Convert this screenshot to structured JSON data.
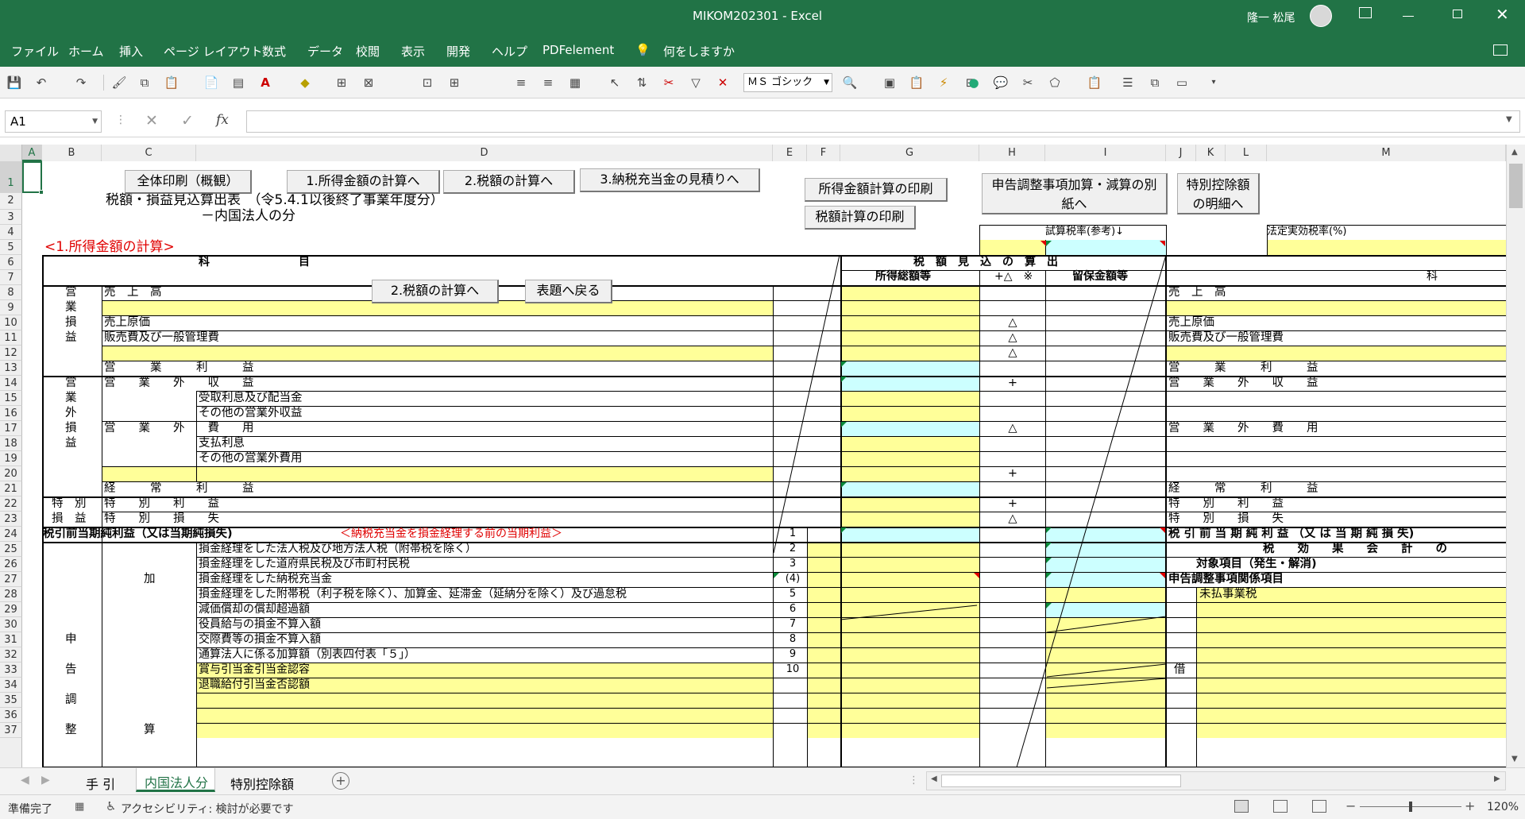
{
  "window": {
    "title": "MIKOM202301 - Excel",
    "user": "隆一 松尾"
  },
  "menu": [
    "ファイル",
    "ホーム",
    "挿入",
    "ページ レイアウト",
    "数式",
    "データ",
    "校閲",
    "表示",
    "開発",
    "ヘルプ",
    "PDFelement"
  ],
  "tellme": "何をしますか",
  "font_box": "ＭＳ ゴシック",
  "namebox": "A1",
  "fx": "fx",
  "columns": [
    "A",
    "B",
    "C",
    "D",
    "E",
    "F",
    "G",
    "H",
    "I",
    "J",
    "K",
    "L",
    "M"
  ],
  "rows": [
    "1",
    "2",
    "3",
    "4",
    "5",
    "6",
    "7",
    "8",
    "9",
    "10",
    "11",
    "12",
    "13",
    "14",
    "15",
    "16",
    "17",
    "18",
    "19",
    "20",
    "21",
    "22",
    "23",
    "24",
    "25",
    "26",
    "27",
    "28",
    "29",
    "30",
    "31",
    "32",
    "33",
    "34",
    "35",
    "36",
    "37"
  ],
  "buttons": {
    "print_all": "全体印刷（概観）",
    "calc_income": "1.所得金額の計算へ",
    "calc_tax": "2.税額の計算へ",
    "provision": "3.納税充当金の見積りへ",
    "print_income": "所得金額計算の印刷",
    "print_tax": "税額計算の印刷",
    "adjust": "申告調整事項加算・減算の別紙へ",
    "special": "特別控除額の明細へ",
    "tax_calc2": "2.税額の計算へ",
    "back": "表題へ戻る"
  },
  "sheet": {
    "title": "税額・損益見込算出表　（令5.4.1以後終了事業年度分）",
    "subtitle": "－内国法人の分",
    "section": "<1.所得金額の計算>",
    "ref_rate": "試算税率(参考)↓",
    "legal_rate": "法定実効税率(%)",
    "h_item": "科　　　　　　　　目",
    "h_est": "税　額　見　込　の　算　出",
    "h_total": "所得総額等",
    "h_mark": "+△　※",
    "h_reserve": "留保金額等",
    "h_m": "科",
    "b8": "営",
    "b9": "業",
    "b10": "損",
    "b11": "益",
    "b14": "営",
    "b15": "業",
    "b16": "外",
    "b17": "損",
    "b18": "益",
    "b22": "特　別",
    "b23": "損　益",
    "r8": "売　上　高",
    "r10": "売上原価",
    "r11": "販売費及び一般管理費",
    "r13": "営　　　業　　　利　　　益",
    "r14": "営　　業　　外　　収　　益",
    "r15": "受取利息及び配当金",
    "r16": "その他の営業外収益",
    "r17": "営　　業　　外　　費　　用",
    "r18": "支払利息",
    "r19": "その他の営業外費用",
    "r21": "経　　　常　　　利　　　益",
    "r22": "特　　別　　利　　益",
    "r23": "特　　別　　損　　失",
    "r24": "税引前当期純利益（又は当期純損失)",
    "r24note": "＜納税充当金を損金経理する前の当期利益＞",
    "r25": "損金経理をした法人税及び地方法人税（附帯税を除く）",
    "r26": "損金経理をした道府県民税及び市町村民税",
    "r27": "損金経理をした納税充当金",
    "r28": "損金経理をした附帯税（利子税を除く）、加算金、延滞金（延納分を除く）及び過怠税",
    "r29": "減価償却の償却超過額",
    "r30": "役員給与の損金不算入額",
    "r31": "交際費等の損金不算入額",
    "r32": "通算法人に係る加算額（別表四付表「５」）",
    "r33": "賞与引当金引当金認容",
    "r34": "退職給付引当金否認額",
    "c27": "加",
    "b31": "申",
    "b33": "告",
    "b35": "調",
    "b37": "整",
    "c37": "算",
    "n24": "1",
    "n25": "2",
    "n26": "3",
    "n27": "(4)",
    "n28": "5",
    "n29": "6",
    "n30": "7",
    "n31": "8",
    "n32": "9",
    "n33": "10",
    "h10": "△",
    "h11": "△",
    "h12": "△",
    "h14": "+",
    "h17": "△",
    "h20": "+",
    "h22": "+",
    "h23": "△",
    "m8": "売　上　高",
    "m10": "売上原価",
    "m11": "販売費及び一般管理費",
    "m13": "営　　　業　　　利　　　益",
    "m14": "営　　業　　外　　収　　益",
    "m17": "営　　業　　外　　費　　用",
    "m21": "経　　　常　　　利　　　益",
    "m22": "特　　別　　利　　益",
    "m23": "特　　別　　損　　失",
    "m24": "税 引 前 当 期 純 利 益 （又 は 当 期 純 損 失)",
    "m25": "税　　効　　果　　会　　計　　の",
    "m26": "対象項目（発生・解消)",
    "m27": "申告調整事項関係項目",
    "m28": "未払事業税",
    "k33": "借"
  },
  "tabs": [
    "手 引",
    "内国法人分",
    "特別控除額"
  ],
  "status": {
    "ready": "準備完了",
    "accessibility": "アクセシビリティ: 検討が必要です",
    "zoom": "120%"
  }
}
